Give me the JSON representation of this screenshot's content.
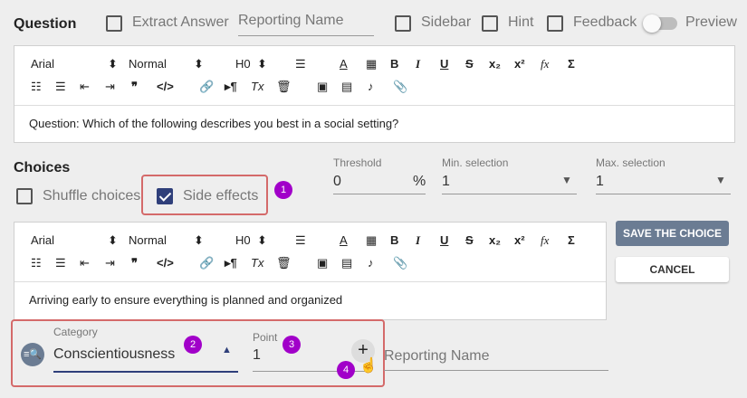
{
  "question": {
    "title": "Question",
    "extract_answer_label": "Extract Answer",
    "reporting_name_placeholder": "Reporting Name",
    "sidebar_label": "Sidebar",
    "hint_label": "Hint",
    "feedback_label": "Feedback",
    "preview_label": "Preview",
    "body_text": "Question: Which of the following describes you best in a social setting?"
  },
  "toolbar": {
    "font": "Arial",
    "style": "Normal",
    "heading": "H0",
    "icons_row1": [
      "align-icon",
      "text-color-icon",
      "highlight-icon",
      "bold-icon",
      "italic-icon",
      "underline-icon",
      "strikethrough-icon",
      "subscript-icon",
      "superscript-icon",
      "formula-icon",
      "sum-icon"
    ],
    "icons_row2": [
      "ordered-list-icon",
      "bullet-list-icon",
      "outdent-icon",
      "indent-icon",
      "quote-icon",
      "code-icon",
      "link-icon",
      "paragraph-direction-icon",
      "clear-format-icon",
      "delete-icon",
      "image-icon",
      "video-icon",
      "audio-icon",
      "attachment-icon"
    ]
  },
  "choices": {
    "title": "Choices",
    "shuffle_label": "Shuffle choices",
    "side_effects_label": "Side effects",
    "threshold_label": "Threshold",
    "threshold_value": "0",
    "threshold_unit": "%",
    "min_selection_label": "Min. selection",
    "min_selection_value": "1",
    "max_selection_label": "Max. selection",
    "max_selection_value": "1",
    "save_button": "SAVE THE CHOICE",
    "cancel_button": "CANCEL",
    "choice_text": "Arriving early to ensure everything is planned and organized",
    "category_label": "Category",
    "category_value": "Conscientiousness",
    "point_label": "Point",
    "point_value": "1",
    "reporting_name_placeholder": "Reporting Name"
  },
  "badges": [
    "1",
    "2",
    "3",
    "4"
  ],
  "colors": {
    "accent": "#2f3f7a",
    "badge": "#a100c9",
    "highlight_box": "#d46a6a",
    "primary_button": "#6b7c93"
  }
}
